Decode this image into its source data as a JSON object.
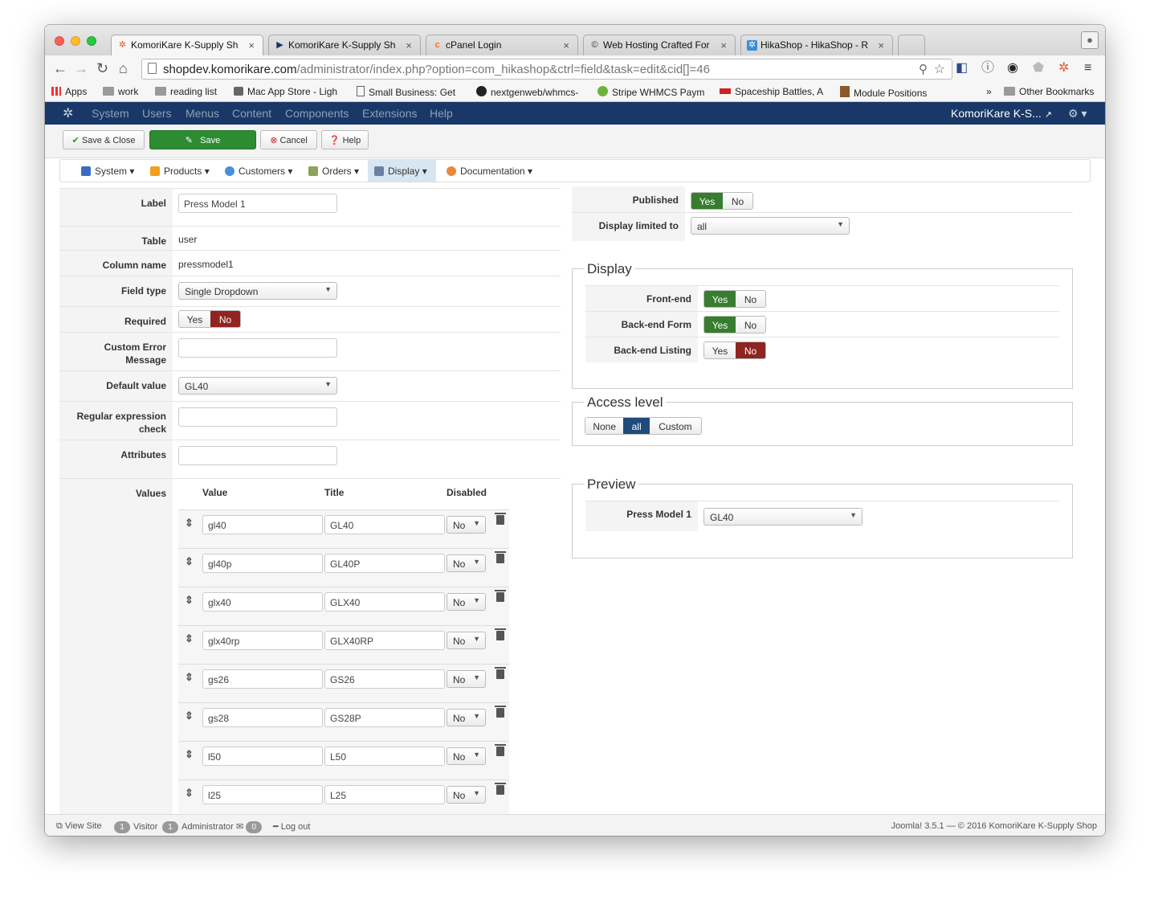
{
  "browser": {
    "tabs": [
      {
        "title": "KomoriKare K-Supply Shop",
        "icon": "joomla-icon"
      },
      {
        "title": "KomoriKare K-Supply Shop",
        "icon": "joomla-play-icon"
      },
      {
        "title": "cPanel Login",
        "icon": "cpanel-icon"
      },
      {
        "title": "Web Hosting Crafted For To",
        "icon": "hosting-icon"
      },
      {
        "title": "HikaShop - HikaShop - Rep",
        "icon": "hikashop-icon"
      }
    ],
    "url_host": "shopdev.komorikare.com",
    "url_path": "/administrator/index.php?option=com_hikashop&ctrl=field&task=edit&cid[]=46",
    "bookmarks": [
      {
        "label": "Apps",
        "icon": "apps-icon"
      },
      {
        "label": "work",
        "icon": "folder-icon"
      },
      {
        "label": "reading list",
        "icon": "folder-icon"
      },
      {
        "label": "Mac App Store - Ligh",
        "icon": "app-store-icon"
      },
      {
        "label": "Small Business: Get",
        "icon": "page-icon"
      },
      {
        "label": "nextgenweb/whmcs-",
        "icon": "github-icon"
      },
      {
        "label": "Stripe WHMCS Paym",
        "icon": "stripe-icon"
      },
      {
        "label": "Spaceship Battles, A",
        "icon": "game-icon"
      },
      {
        "label": "Module Positions",
        "icon": "module-icon"
      }
    ],
    "bookmarks_more": "»",
    "other_bookmarks": "Other Bookmarks"
  },
  "admin_nav": {
    "menu": [
      "System",
      "Users",
      "Menus",
      "Content",
      "Components",
      "Extensions",
      "Help"
    ],
    "site_name": "KomoriKare K-S...",
    "site_link_icon": "external-link-icon",
    "settings_icon": "gear-icon"
  },
  "toolbar": {
    "save_close": "Save & Close",
    "save": "Save",
    "cancel": "Cancel",
    "help": "Help"
  },
  "submenu": [
    {
      "label": "System",
      "icon": "tools-icon",
      "color": "#3b6cc4"
    },
    {
      "label": "Products",
      "icon": "products-icon",
      "color": "#f0a020"
    },
    {
      "label": "Customers",
      "icon": "customers-icon",
      "color": "#4a8fd8"
    },
    {
      "label": "Orders",
      "icon": "orders-icon",
      "color": "#8ba35a"
    },
    {
      "label": "Display",
      "icon": "display-icon",
      "color": "#6c7fa8"
    },
    {
      "label": "Documentation",
      "icon": "documentation-icon",
      "color": "#e88a3a"
    }
  ],
  "form": {
    "label": {
      "label": "Label",
      "value": "Press Model 1"
    },
    "table": {
      "label": "Table",
      "value": "user"
    },
    "column_name": {
      "label": "Column name",
      "value": "pressmodel1"
    },
    "field_type": {
      "label": "Field type",
      "value": "Single Dropdown"
    },
    "required": {
      "label": "Required",
      "yes": "Yes",
      "no": "No",
      "selected": "No"
    },
    "custom_error": {
      "label_1": "Custom Error",
      "label_2": "Message",
      "value": ""
    },
    "default_value": {
      "label": "Default value",
      "value": "GL40"
    },
    "regex": {
      "label_1": "Regular expression",
      "label_2": "check",
      "value": ""
    },
    "attributes": {
      "label": "Attributes",
      "value": ""
    },
    "values": {
      "label": "Values",
      "col_value": "Value",
      "col_title": "Title",
      "col_disabled": "Disabled",
      "rows": [
        {
          "value": "gl40",
          "title": "GL40",
          "disabled": "No"
        },
        {
          "value": "gl40p",
          "title": "GL40P",
          "disabled": "No"
        },
        {
          "value": "glx40",
          "title": "GLX40",
          "disabled": "No"
        },
        {
          "value": "glx40rp",
          "title": "GLX40RP",
          "disabled": "No"
        },
        {
          "value": "gs26",
          "title": "GS26",
          "disabled": "No"
        },
        {
          "value": "gs28",
          "title": "GS28P",
          "disabled": "No"
        },
        {
          "value": "l50",
          "title": "L50",
          "disabled": "No"
        },
        {
          "value": "l25",
          "title": "L25",
          "disabled": "No"
        }
      ]
    }
  },
  "right": {
    "published": {
      "label": "Published",
      "yes": "Yes",
      "no": "No",
      "selected": "Yes"
    },
    "display_limited": {
      "label": "Display limited to",
      "value": "all"
    },
    "display": {
      "legend": "Display",
      "frontend": {
        "label": "Front-end",
        "yes": "Yes",
        "no": "No",
        "selected": "Yes"
      },
      "backend_form": {
        "label": "Back-end Form",
        "yes": "Yes",
        "no": "No",
        "selected": "Yes"
      },
      "backend_listing": {
        "label": "Back-end Listing",
        "yes": "Yes",
        "no": "No",
        "selected": "No"
      }
    },
    "access": {
      "legend": "Access level",
      "none": "None",
      "all": "all",
      "custom": "Custom",
      "selected": "all"
    },
    "preview": {
      "legend": "Preview",
      "label": "Press Model 1",
      "value": "GL40"
    }
  },
  "footer": {
    "view_site": "View Site",
    "visitor_count": "1",
    "visitor": "Visitor",
    "admin_count": "1",
    "admin": "Administrator",
    "messages_count": "0",
    "logout": "Log out",
    "version": "Joomla! 3.5.1",
    "copyright": "— © 2016 KomoriKare K-Supply Shop"
  },
  "colors": {
    "admin_nav_bg": "#1a3867",
    "save_green": "#2d8b32",
    "yes_green": "#377d2f",
    "no_red": "#8e2521",
    "all_blue": "#1f4b7a"
  }
}
